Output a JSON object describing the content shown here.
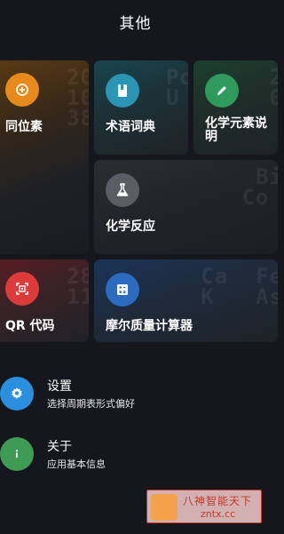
{
  "header": {
    "title": "其他"
  },
  "tiles": [
    {
      "label": "同位素",
      "icon": "isotope-icon",
      "color": "#e8891b"
    },
    {
      "label": "术语词典",
      "icon": "book-icon",
      "color": "#2a95b5"
    },
    {
      "label": "化学元素说明",
      "icon": "pencil-icon",
      "color": "#2e9a5c"
    },
    {
      "label": "化学反应",
      "icon": "flask-icon",
      "color": "#5a5d63"
    },
    {
      "label": "QR 代码",
      "icon": "qr-scan-icon",
      "color": "#dd3b3b"
    },
    {
      "label": "摩尔质量计算器",
      "icon": "calculator-icon",
      "color": "#2b6cc0"
    }
  ],
  "list": [
    {
      "title": "设置",
      "subtitle": "选择周期表形式偏好",
      "icon": "gear-icon",
      "color": "#2b8fe0"
    },
    {
      "title": "关于",
      "subtitle": "应用基本信息",
      "icon": "info-icon",
      "color": "#3f9a54"
    }
  ],
  "watermark": {
    "line1": "八神智能天下",
    "line2": "zntx.cc"
  }
}
